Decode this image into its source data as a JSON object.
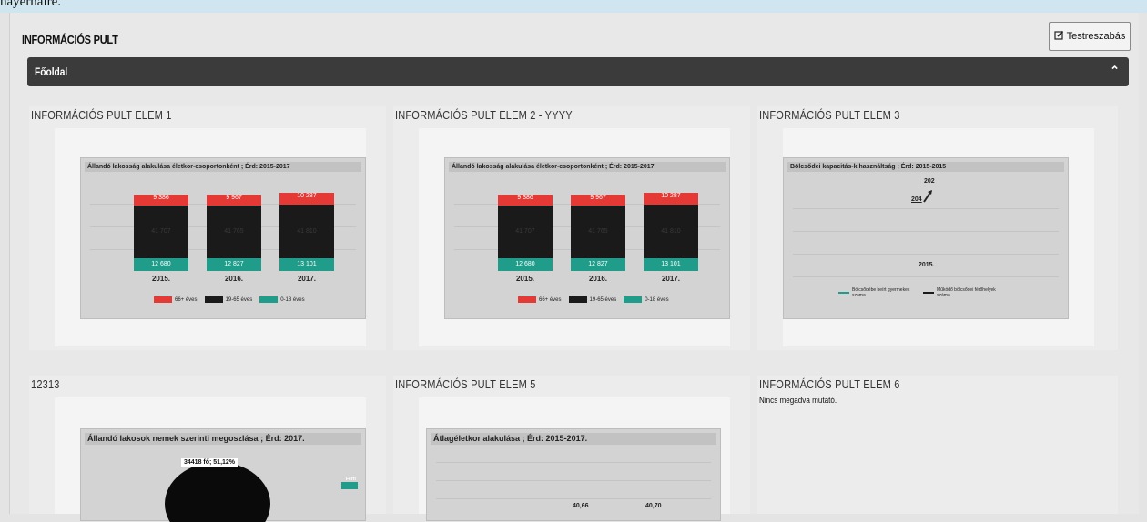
{
  "top_text": "hayernaire.",
  "header": {
    "title": "INFORMÁCIÓS PULT",
    "customize_button": "Testreszabás"
  },
  "section": {
    "label": "Főoldal"
  },
  "tiles": [
    {
      "title": "INFORMÁCIÓS PULT ELEM 1"
    },
    {
      "title": "INFORMÁCIÓS PULT ELEM 2 - YYYY"
    },
    {
      "title": "INFORMÁCIÓS PULT ELEM 3"
    },
    {
      "title": "12313"
    },
    {
      "title": "INFORMÁCIÓS PULT ELEM 5"
    },
    {
      "title": "INFORMÁCIÓS PULT ELEM 6",
      "note": "Nincs megadva mutató."
    }
  ],
  "chart_data": [
    {
      "type": "bar",
      "stacked": true,
      "title": "Állandó lakosság alakulása életkor-csoportonként ; Érd: 2015-2017",
      "categories": [
        "2015.",
        "2016.",
        "2017."
      ],
      "series": [
        {
          "name": "66+ éves",
          "color": "#e53935",
          "labels": [
            "9 386",
            "9 967",
            "10 287"
          ]
        },
        {
          "name": "19-65 éves",
          "color": "#1a1a1a",
          "labels": [
            "41 707",
            "41 765",
            "41 810"
          ]
        },
        {
          "name": "0-18 éves",
          "color": "#1f9c8a",
          "labels": [
            "12 680",
            "12 827",
            "13 101"
          ]
        }
      ]
    },
    {
      "type": "bar",
      "stacked": true,
      "title": "Állandó lakosság alakulása életkor-csoportonként ; Érd: 2015-2017",
      "categories": [
        "2015.",
        "2016.",
        "2017."
      ],
      "series": [
        {
          "name": "66+ éves",
          "color": "#e53935",
          "labels": [
            "9 386",
            "9 967",
            "10 287"
          ]
        },
        {
          "name": "19-65 éves",
          "color": "#1a1a1a",
          "labels": [
            "41 707",
            "41 765",
            "41 810"
          ]
        },
        {
          "name": "0-18 éves",
          "color": "#1f9c8a",
          "labels": [
            "12 680",
            "12 827",
            "13 101"
          ]
        }
      ]
    },
    {
      "type": "line",
      "title": "Bölcsődei kapacitás-kihasználtság ; Érd: 2015-2015",
      "categories": [
        "2015."
      ],
      "labels": [
        "202",
        "204"
      ],
      "series": [
        {
          "name": "Bölcsődébe beírt gyermekek száma",
          "color": "#1f9c8a"
        },
        {
          "name": "Működő bölcsődei férőhelyek száma",
          "color": "#1a1a1a"
        }
      ]
    },
    {
      "type": "pie",
      "title": "Állandó lakosok nemek szerinti megoszlása ; Érd: 2017.",
      "slice_label": "34418 fő; 51,12%",
      "legend": [
        "Férfi"
      ]
    },
    {
      "type": "line",
      "title": "Átlagéletkor alakulása ; Érd: 2015-2017.",
      "labels": [
        "40,66",
        "40,70"
      ]
    }
  ]
}
